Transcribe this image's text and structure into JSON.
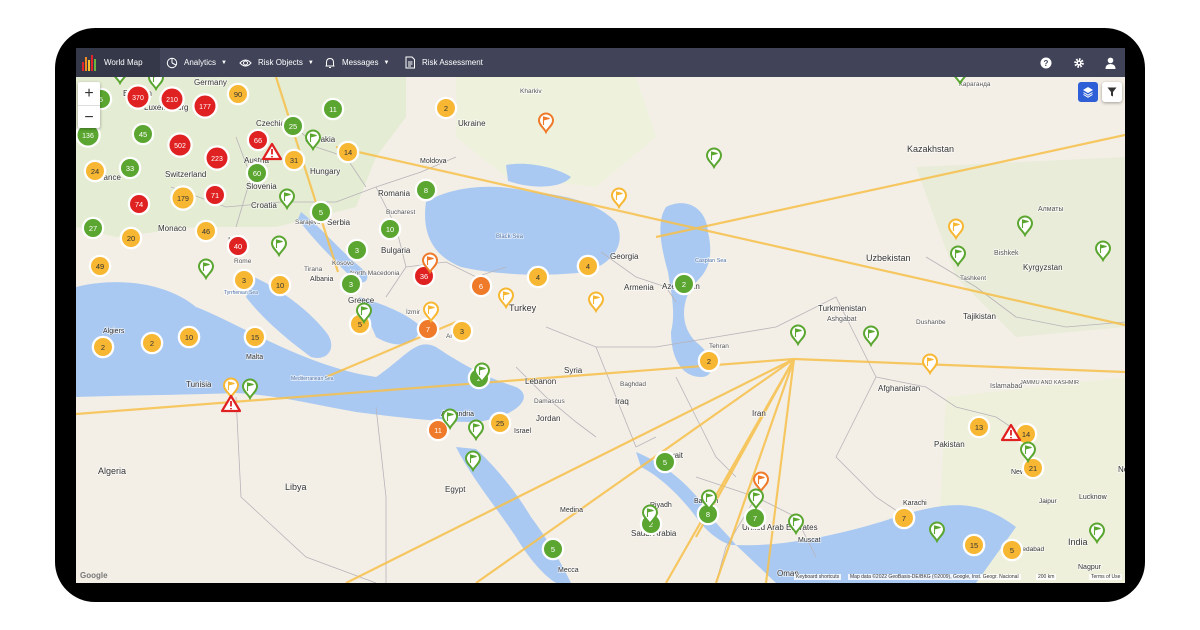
{
  "nav": {
    "brand": "World Map",
    "items": [
      {
        "label": "Analytics",
        "icon": "pie-chart-icon"
      },
      {
        "label": "Risk Objects",
        "icon": "eye-icon"
      },
      {
        "label": "Messages",
        "icon": "bell-icon"
      },
      {
        "label": "Risk Assessment",
        "icon": "document-icon"
      }
    ],
    "right_icons": [
      "help-icon",
      "gear-icon",
      "user-icon"
    ]
  },
  "map": {
    "zoom_in": "+",
    "zoom_out": "−",
    "controls": [
      "layers-icon",
      "filter-icon"
    ],
    "labels": {
      "ukraine": "Ukraine",
      "kazakhstan": "Kazakhstan",
      "czechia": "Czechia",
      "slovakia": "Slovakia",
      "moldova": "Moldova",
      "austria": "Austria",
      "hungary": "Hungary",
      "switzerland": "Switzerland",
      "france": "France",
      "slovenia": "Slovenia",
      "croatia": "Croatia",
      "romania": "Romania",
      "bucharest": "Bucharest",
      "serbia": "Serbia",
      "sarajevo": "Sarajevo",
      "monaco": "Monaco",
      "italy": "Italy",
      "rome": "Rome",
      "bulgaria": "Bulgaria",
      "kosovo": "Kosovo",
      "north_macedonia": "North Macedonia",
      "tirana": "Tirana",
      "albania": "Albania",
      "greece": "Greece",
      "black_sea": "Black Sea",
      "georgia": "Georgia",
      "armenia": "Armenia",
      "azerbaijan": "Azerbaijan",
      "caspian_sea": "Caspian Sea",
      "uzbekistan": "Uzbekistan",
      "bishkek": "Bishkek",
      "kyrgyzstan": "Kyrgyzstan",
      "tashkent": "Tashkent",
      "almaty": "Алматы",
      "karaganda": "Караганда",
      "turkey": "Turkey",
      "izmir": "İzmir",
      "antalya": "Antalya",
      "turkmenistan": "Turkmenistan",
      "ashgabat": "Ashgabat",
      "tajikistan": "Tajikistan",
      "dushanbe": "Dushanbe",
      "tehran": "Tehran",
      "afghanistan": "Afghanistan",
      "algiers": "Algiers",
      "tunisia": "Tunisia",
      "malta": "Malta",
      "tyrrhenian_sea": "Tyrrhenian Sea",
      "mediterranean_sea": "Mediterranean Sea",
      "syria": "Syria",
      "lebanon": "Lebanon",
      "damascus": "Damascus",
      "baghdad": "Baghdad",
      "iraq": "Iraq",
      "jordan": "Jordan",
      "israel": "Israel",
      "alexandria": "Alexandria",
      "iran": "Iran",
      "islamabad": "Islamabad",
      "jammu_kashmir": "JAMMU AND KASHMIR",
      "pakistan": "Pakistan",
      "new_delhi": "New Delhi",
      "lucknow": "Lucknow",
      "nepal": "Nepal",
      "algeria": "Algeria",
      "libya": "Libya",
      "egypt": "Egypt",
      "kuwait": "Kuwait",
      "riyadh": "Riyadh",
      "bahrain": "Bahrain",
      "medina": "Medina",
      "saudi_arabia": "Saudi Arabia",
      "uae": "United Arab Emirates",
      "muscat": "Muscat",
      "karachi": "Karachi",
      "india": "India",
      "nagpur": "Nagpur",
      "oman": "Oman",
      "mecca": "Mecca",
      "germany": "Germany",
      "belgium": "Belgium",
      "luxembourg": "Luxembourg",
      "ahmedabad": "Ahmedabad",
      "jaipur": "Jaipur",
      "kharkiv": "Kharkiv"
    },
    "clusters": [
      {
        "count": "5",
        "tone": "green"
      },
      {
        "count": "370",
        "tone": "red"
      },
      {
        "count": "210",
        "tone": "red"
      },
      {
        "count": "177",
        "tone": "red"
      },
      {
        "count": "90",
        "tone": "yellow"
      },
      {
        "count": "2",
        "tone": "yellow"
      },
      {
        "count": "11",
        "tone": "green"
      },
      {
        "count": "45",
        "tone": "green"
      },
      {
        "count": "136",
        "tone": "green"
      },
      {
        "count": "502",
        "tone": "red"
      },
      {
        "count": "66",
        "tone": "red"
      },
      {
        "count": "25",
        "tone": "green"
      },
      {
        "count": "223",
        "tone": "red"
      },
      {
        "count": "31",
        "tone": "yellow"
      },
      {
        "count": "14",
        "tone": "yellow"
      },
      {
        "count": "24",
        "tone": "yellow"
      },
      {
        "count": "33",
        "tone": "green"
      },
      {
        "count": "60",
        "tone": "green"
      },
      {
        "count": "8",
        "tone": "green"
      },
      {
        "count": "71",
        "tone": "red"
      },
      {
        "count": "179",
        "tone": "yellow"
      },
      {
        "count": "74",
        "tone": "red"
      },
      {
        "count": "5",
        "tone": "green"
      },
      {
        "count": "27",
        "tone": "green"
      },
      {
        "count": "20",
        "tone": "yellow"
      },
      {
        "count": "46",
        "tone": "yellow"
      },
      {
        "count": "40",
        "tone": "red"
      },
      {
        "count": "10",
        "tone": "green"
      },
      {
        "count": "3",
        "tone": "green"
      },
      {
        "count": "49",
        "tone": "yellow"
      },
      {
        "count": "36",
        "tone": "red"
      },
      {
        "count": "4",
        "tone": "yellow"
      },
      {
        "count": "4",
        "tone": "yellow"
      },
      {
        "count": "3",
        "tone": "yellow"
      },
      {
        "count": "10",
        "tone": "yellow"
      },
      {
        "count": "3",
        "tone": "green"
      },
      {
        "count": "6",
        "tone": "orange"
      },
      {
        "count": "2",
        "tone": "green"
      },
      {
        "count": "5",
        "tone": "yellow"
      },
      {
        "count": "7",
        "tone": "orange"
      },
      {
        "count": "3",
        "tone": "yellow"
      },
      {
        "count": "15",
        "tone": "yellow"
      },
      {
        "count": "2",
        "tone": "yellow"
      },
      {
        "count": "2",
        "tone": "yellow"
      },
      {
        "count": "10",
        "tone": "yellow"
      },
      {
        "count": "2",
        "tone": "yellow"
      },
      {
        "count": "2",
        "tone": "green"
      },
      {
        "count": "11",
        "tone": "orange"
      },
      {
        "count": "25",
        "tone": "yellow"
      },
      {
        "count": "5",
        "tone": "green"
      },
      {
        "count": "8",
        "tone": "green"
      },
      {
        "count": "7",
        "tone": "green"
      },
      {
        "count": "2",
        "tone": "green"
      },
      {
        "count": "5",
        "tone": "green"
      },
      {
        "count": "13",
        "tone": "yellow"
      },
      {
        "count": "14",
        "tone": "yellow"
      },
      {
        "count": "21",
        "tone": "yellow"
      },
      {
        "count": "7",
        "tone": "yellow"
      },
      {
        "count": "15",
        "tone": "yellow"
      },
      {
        "count": "5",
        "tone": "yellow"
      }
    ],
    "pins": [
      {
        "tone": "green"
      },
      {
        "tone": "green"
      },
      {
        "tone": "orange"
      },
      {
        "tone": "green"
      },
      {
        "tone": "green"
      },
      {
        "tone": "yellow"
      },
      {
        "tone": "green"
      },
      {
        "tone": "yellow"
      },
      {
        "tone": "green"
      },
      {
        "tone": "orange"
      },
      {
        "tone": "green"
      },
      {
        "tone": "yellow"
      },
      {
        "tone": "green"
      },
      {
        "tone": "yellow"
      },
      {
        "tone": "yellow"
      },
      {
        "tone": "green"
      },
      {
        "tone": "green"
      },
      {
        "tone": "green"
      },
      {
        "tone": "green"
      },
      {
        "tone": "green"
      },
      {
        "tone": "green"
      },
      {
        "tone": "green"
      },
      {
        "tone": "green"
      },
      {
        "tone": "orange"
      },
      {
        "tone": "green"
      },
      {
        "tone": "green"
      },
      {
        "tone": "green"
      },
      {
        "tone": "green"
      },
      {
        "tone": "yellow"
      },
      {
        "tone": "yellow"
      },
      {
        "tone": "green"
      },
      {
        "tone": "green"
      },
      {
        "tone": "green"
      },
      {
        "tone": "green"
      },
      {
        "tone": "green"
      },
      {
        "tone": "green"
      }
    ],
    "alerts": [
      {
        "tone": "red"
      },
      {
        "tone": "red"
      },
      {
        "tone": "red"
      }
    ],
    "attribution": {
      "google": "Google",
      "shortcuts": "Keyboard shortcuts",
      "data": "Map data ©2022 GeoBasis-DE/BKG (©2009), Google, Inst. Geogr. Nacional",
      "scale": "200 km",
      "terms": "Terms of Use"
    }
  },
  "colors": {
    "nav_bg": "#414458",
    "brand_bg": "#353849",
    "land": "#f3efe6",
    "water": "#aac9f2",
    "cluster_red": "#e02121",
    "cluster_orange": "#ee7a2a",
    "cluster_yellow": "#f7b733",
    "cluster_green": "#5aa630",
    "route_line": "#f7c04a"
  }
}
